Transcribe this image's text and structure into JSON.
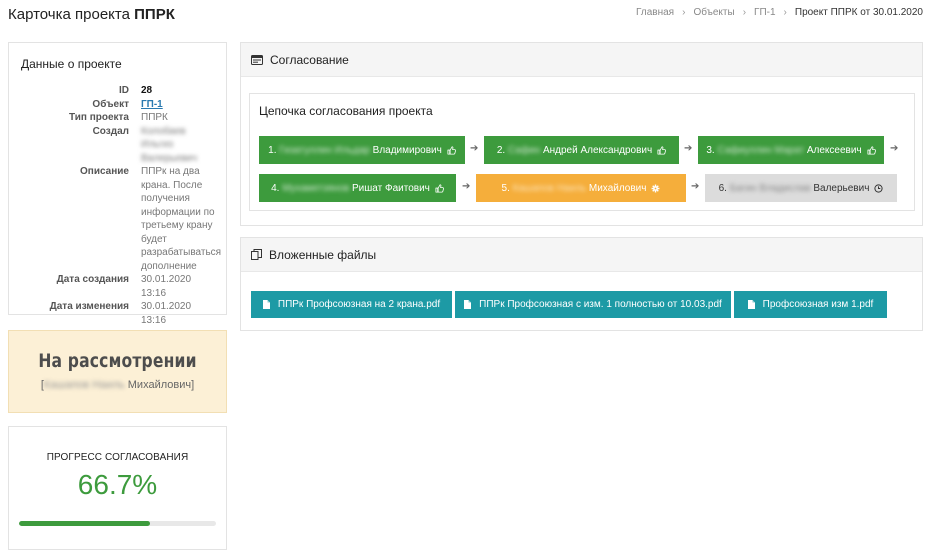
{
  "page_title_prefix": "Карточка проекта",
  "page_title_bold": "ППРК",
  "breadcrumb": [
    "Главная",
    "Объекты",
    "ГП-1",
    "Проект ППРК от 30.01.2020"
  ],
  "project": {
    "title": "Данные о проекте",
    "rows": [
      {
        "label": "ID",
        "value": "28"
      },
      {
        "label": "Объект",
        "value": "ГП-1"
      },
      {
        "label": "Тип проекта",
        "value": "ППРК"
      },
      {
        "label": "Создал",
        "value": "Колобаев Ильгиз Валерьевич"
      },
      {
        "label": "Описание",
        "value": "ППРк на два крана. После получения информации по третьему крану будет разрабатываться дополнение"
      },
      {
        "label": "Дата создания",
        "value": "30.01.2020 13:16"
      },
      {
        "label": "Дата изменения",
        "value": "30.01.2020 13:16"
      }
    ]
  },
  "status": {
    "title": "На рассмотрении",
    "person_blurred": "Кашапов Наиль",
    "person_visible": "Михайлович"
  },
  "progress": {
    "label": "ПРОГРЕСС СОГЛАСОВАНИЯ",
    "value_text": "66.7%",
    "fraction": 0.667
  },
  "approval": {
    "title": "Согласование",
    "chain_title": "Цепочка согласования проекта",
    "steps": [
      {
        "num": "1.",
        "blurred": "Гизатуллин Ильдар",
        "visible": "Владимирович",
        "status": "approved"
      },
      {
        "num": "2.",
        "blurred": "Сафин",
        "visible": "Андрей Александрович",
        "status": "approved"
      },
      {
        "num": "3.",
        "blurred": "Сафиуллин Марат",
        "visible": "Алексеевич",
        "status": "approved"
      },
      {
        "num": "4.",
        "blurred": "Мухаметзянов",
        "visible": "Ришат Фаитович",
        "status": "approved"
      },
      {
        "num": "5.",
        "blurred": "Кашапов Наиль",
        "visible": "Михайлович",
        "status": "current"
      },
      {
        "num": "6.",
        "blurred": "Багин Владислав",
        "visible": "Валерьевич",
        "status": "pending"
      }
    ]
  },
  "files": {
    "title": "Вложенные файлы",
    "items": [
      "ППРк Профсоюзная на 2 крана.pdf",
      "ППРк Профсоюзная с изм. 1 полностью от 10.03.pdf",
      "Профсоюзная изм 1.pdf"
    ]
  },
  "colors": {
    "approved": "#3d9b3d",
    "current": "#f5ae3b",
    "pending": "#dcdcdc",
    "file_button": "#1d9aa5",
    "status_bg": "#fcf0d6"
  }
}
